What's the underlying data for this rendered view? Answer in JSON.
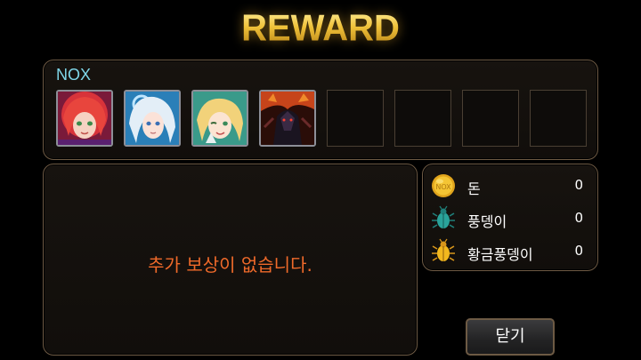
{
  "title": "REWARD",
  "team": {
    "name": "NOX",
    "slots": [
      {
        "filled": true,
        "portrait": "red-haired-girl-portrait-icon"
      },
      {
        "filled": true,
        "portrait": "white-haired-girl-portrait-icon"
      },
      {
        "filled": true,
        "portrait": "blonde-elf-portrait-icon"
      },
      {
        "filled": true,
        "portrait": "dark-demon-portrait-icon"
      },
      {
        "filled": false
      },
      {
        "filled": false
      },
      {
        "filled": false
      },
      {
        "filled": false
      }
    ]
  },
  "message": "추가 보상이 없습니다.",
  "resources": [
    {
      "icon": "gold-coin-icon",
      "label": "돈",
      "value": "0"
    },
    {
      "icon": "teal-beetle-icon",
      "label": "풍뎅이",
      "value": "0"
    },
    {
      "icon": "golden-beetle-icon",
      "label": "황금풍뎅이",
      "value": "0"
    }
  ],
  "close_label": "닫기",
  "colors": {
    "title_gold": "#e6b62a",
    "team_name": "#7fd6e8",
    "message": "#f06a2a",
    "panel_border": "#6e5a44"
  }
}
